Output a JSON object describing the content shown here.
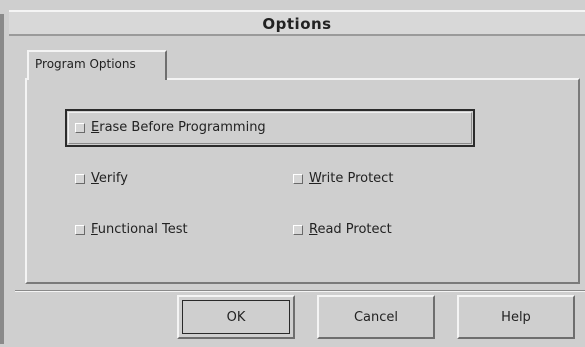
{
  "dialog": {
    "title": "Options"
  },
  "tabs": [
    {
      "label": "Program Options"
    }
  ],
  "options": {
    "erase": {
      "pre": "",
      "mnemonic": "E",
      "rest": "rase Before Programming",
      "checked": false
    },
    "verify": {
      "pre": "",
      "mnemonic": "V",
      "rest": "erify",
      "checked": false
    },
    "write_protect": {
      "pre": "",
      "mnemonic": "W",
      "rest": "rite Protect",
      "checked": false
    },
    "functional_test": {
      "pre": "",
      "mnemonic": "F",
      "rest": "unctional Test",
      "checked": false
    },
    "read_protect": {
      "pre": "",
      "mnemonic": "R",
      "rest": "ead Protect",
      "checked": false
    }
  },
  "buttons": {
    "ok": "OK",
    "cancel": "Cancel",
    "help": "Help"
  }
}
